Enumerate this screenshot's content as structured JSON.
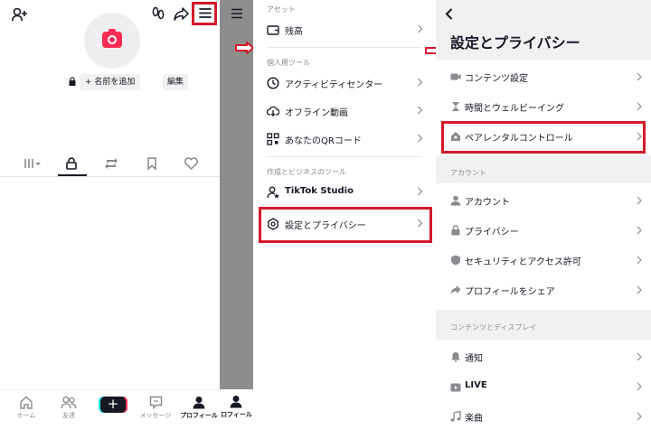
{
  "profile": {
    "name_button": "+ 名前を追加",
    "edit_button": "編集",
    "bottom_nav": [
      {
        "label": "ホーム",
        "icon": "home-icon"
      },
      {
        "label": "友達",
        "icon": "friends-icon"
      },
      {
        "label": "",
        "icon": "plus-icon"
      },
      {
        "label": "メッセージ",
        "icon": "message-icon"
      },
      {
        "label": "プロフィール",
        "icon": "profile-icon"
      }
    ],
    "strip_nav_label": "ロフィール"
  },
  "menu": {
    "section_asset": "アセット",
    "balance": "残高",
    "section_personal": "個人用ツール",
    "activity_center": "アクティビティセンター",
    "offline_video": "オフライン動画",
    "your_qr": "あなたのQRコード",
    "section_creator": "作成とビジネスのツール",
    "tiktok_studio": "TikTok Studio",
    "settings_privacy": "設定とプライバシー"
  },
  "settings": {
    "title": "設定とプライバシー",
    "items_top": [
      "コンテンツ設定",
      "時間とウェルビーイング",
      "ペアレンタルコントロール"
    ],
    "section_account": "アカウント",
    "items_account": [
      "アカウント",
      "プライバシー",
      "セキュリティとアクセス許可",
      "プロフィールをシェア"
    ],
    "section_content": "コンテンツとディスプレイ",
    "items_content": [
      "通知",
      "LIVE",
      "楽曲"
    ]
  },
  "colors": {
    "accent": "#fe2c55",
    "highlight": "#d3182b"
  }
}
